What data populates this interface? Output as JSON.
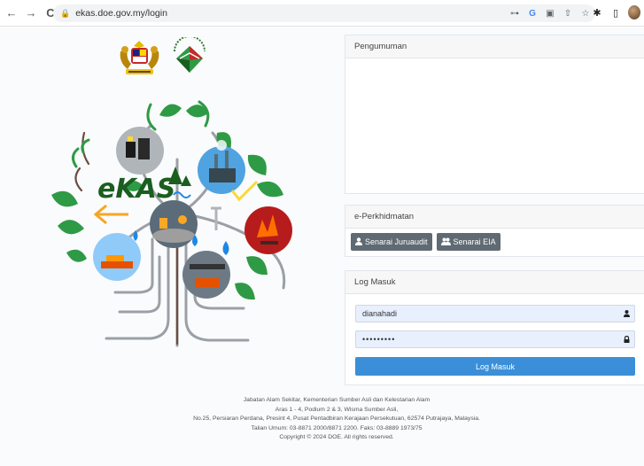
{
  "browser": {
    "url": "ekas.doe.gov.my/login",
    "back": "←",
    "forward": "→",
    "reload": "C",
    "lock": "🔒",
    "omni_icons": [
      "⊶",
      "G",
      "▣",
      "⇧",
      "☆"
    ],
    "ext_icons": [
      "✱",
      "▯"
    ]
  },
  "announcement": {
    "title": "Pengumuman"
  },
  "services": {
    "title": "e-Perkhidmatan",
    "auditor_button": "Senarai Juruaudit",
    "eia_button": "Senarai EIA",
    "auditor_icon": "user-icon",
    "eia_icon": "users-icon"
  },
  "login": {
    "title": "Log Masuk",
    "username": "dianahadi",
    "password": "•••••••••",
    "submit": "Log Masuk"
  },
  "footer": {
    "line1": "Jabatan Alam Sekitar, Kementerian Sumber Asli dan Kelestarian Alam",
    "line2": "Aras 1 - 4, Podium 2 & 3, Wisma Sumber Asli,",
    "line3": "No.25, Persiaran Perdana, Presint 4, Pusat Pentadbiran Kerajaan Persekutuan, 62574 Putrajaya, Malaysia.",
    "line4": "Talian Umum: 03-8871 2000/8871 2200. Faks: 03-8889 1973/75",
    "line5": "Copyright © 2024 DOE. All rights reserved."
  },
  "hero": {
    "brand": "eKAS"
  },
  "colors": {
    "primary": "#3b8fd8",
    "button_dark": "#5f6a73",
    "leaf_green": "#2e9a45",
    "input_bg": "#e8f0fe"
  }
}
